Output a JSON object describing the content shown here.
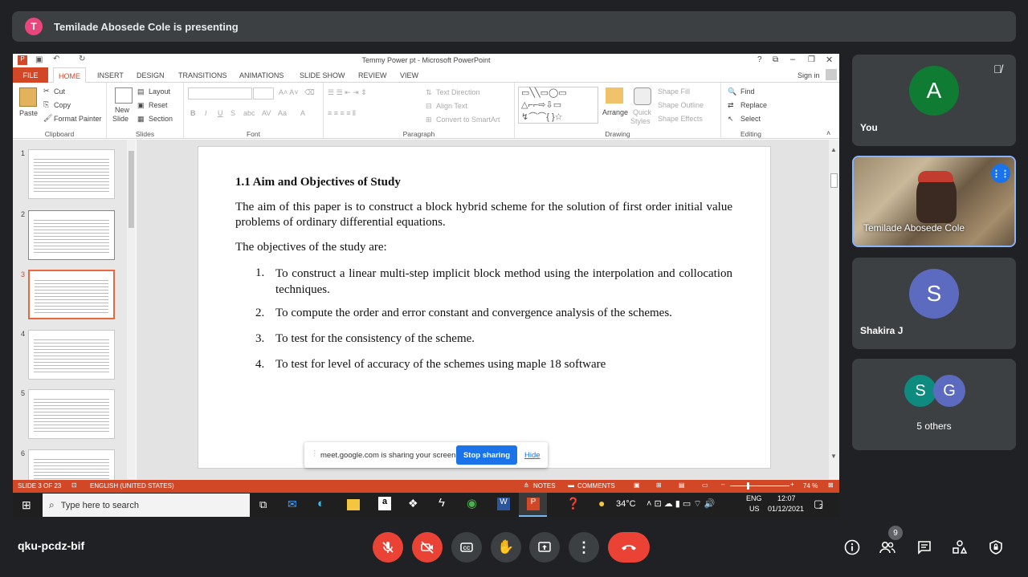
{
  "banner": {
    "avatar_letter": "T",
    "text": "Temilade Abosede Cole is presenting"
  },
  "ppt": {
    "window_title": "Temmy Power pt - Microsoft PowerPoint",
    "tabs": [
      "FILE",
      "HOME",
      "INSERT",
      "DESIGN",
      "TRANSITIONS",
      "ANIMATIONS",
      "SLIDE SHOW",
      "REVIEW",
      "VIEW"
    ],
    "sign_in": "Sign in",
    "ribbon": {
      "clipboard": {
        "label": "Clipboard",
        "paste": "Paste",
        "cut": "Cut",
        "copy": "Copy",
        "format_painter": "Format Painter"
      },
      "slides": {
        "label": "Slides",
        "new_slide": "New",
        "new_slide_2": "Slide",
        "layout": "Layout",
        "reset": "Reset",
        "section": "Section"
      },
      "font": {
        "label": "Font"
      },
      "paragraph": {
        "label": "Paragraph",
        "text_direction": "Text Direction",
        "align_text": "Align Text",
        "convert": "Convert to SmartArt"
      },
      "drawing": {
        "label": "Drawing",
        "arrange": "Arrange",
        "quick_styles": "Quick",
        "quick_styles_2": "Styles",
        "shape_fill": "Shape Fill",
        "shape_outline": "Shape Outline",
        "shape_effects": "Shape Effects"
      },
      "editing": {
        "label": "Editing",
        "find": "Find",
        "replace": "Replace",
        "select": "Select"
      }
    },
    "thumbnails": [
      {
        "n": "1"
      },
      {
        "n": "2"
      },
      {
        "n": "3"
      },
      {
        "n": "4"
      },
      {
        "n": "5"
      },
      {
        "n": "6"
      }
    ],
    "selected_slide": "3",
    "slide": {
      "heading": "1.1 Aim and Objectives of Study",
      "para1": "The aim of this paper is to construct a block hybrid scheme for the solution of first order initial value problems of ordinary differential equations.",
      "para2": "The objectives of the study are:",
      "items": [
        {
          "num": "1.",
          "text": "To construct a linear multi-step implicit block method using the interpolation and collocation techniques."
        },
        {
          "num": "2.",
          "text": "To compute the order and error constant and convergence analysis of the schemes."
        },
        {
          "num": "3.",
          "text": "To test for the consistency of the scheme."
        },
        {
          "num": "4.",
          "text": "To test for level of accuracy of the schemes using maple 18 software"
        }
      ]
    },
    "status": {
      "slide_of": "SLIDE 3 OF 23",
      "language": "ENGLISH (UNITED STATES)",
      "notes": "NOTES",
      "comments": "COMMENTS",
      "zoom": "74 %"
    }
  },
  "taskbar": {
    "search_placeholder": "Type here to search",
    "temp": "34°C",
    "lang1": "ENG",
    "lang2": "US",
    "time": "12:07",
    "date": "01/12/2021",
    "notif_count": "2"
  },
  "toast": {
    "message": "meet.google.com is sharing your screen.",
    "stop": "Stop sharing",
    "hide": "Hide"
  },
  "participants": {
    "you": {
      "letter": "A",
      "name": "You",
      "color": "#0f7b33"
    },
    "presenter": {
      "name": "Temilade Abosede Cole"
    },
    "shakira": {
      "letter": "S",
      "name": "Shakira J",
      "color": "#5c6bc0"
    },
    "others": {
      "letter1": "S",
      "letter2": "G",
      "name": "5 others",
      "color1": "#0f8a7e",
      "color2": "#5c6bc0"
    }
  },
  "meet": {
    "code": "qku-pcdz-bif",
    "people_count": "9"
  }
}
